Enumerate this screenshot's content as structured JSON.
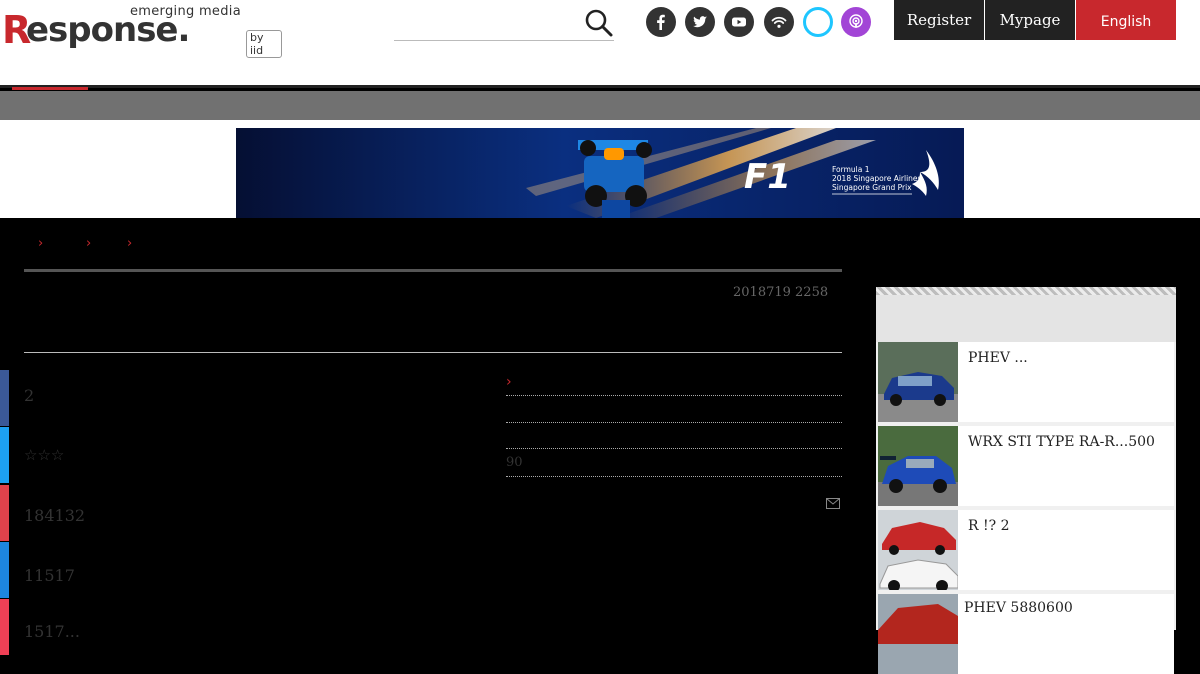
{
  "header": {
    "logo_tagline": "emerging media",
    "logo_word": "esponse.",
    "logo_initial": "R",
    "logo_by": "by iid",
    "search_placeholder": "",
    "buttons": {
      "register": "Register",
      "mypage": "Mypage",
      "english": "English"
    },
    "social": [
      {
        "icon": "facebook-icon",
        "color": "#333333"
      },
      {
        "icon": "twitter-icon",
        "color": "#333333"
      },
      {
        "icon": "youtube-icon",
        "color": "#333333"
      },
      {
        "icon": "rss-icon",
        "color": "#333333"
      },
      {
        "icon": "alexa-icon",
        "color": "#1ec6ff"
      },
      {
        "icon": "podcast-icon",
        "color": "#a245d6"
      }
    ]
  },
  "ad": {
    "brand": "F1",
    "line1": "Formula 1",
    "line2": "2018 Singapore Airlines",
    "line3": "Singapore Grand Prix"
  },
  "article": {
    "date": "2018719 2258",
    "counts": [
      "2",
      "184132",
      "11517",
      "1517..."
    ],
    "rating": "☆☆☆",
    "related_number": "90"
  },
  "ranking": [
    {
      "title": "PHEV ..."
    },
    {
      "title": "WRX STI TYPE RA-R...500"
    },
    {
      "title": "R !? 2"
    },
    {
      "title": "PHEV 5880600"
    }
  ],
  "colors": {
    "accent": "#c8282d",
    "dark_button": "#222222",
    "facebook": "#3b5998",
    "twitter": "#1da1f2",
    "hatena": "#e0424b",
    "pocket": "#ef4056"
  }
}
